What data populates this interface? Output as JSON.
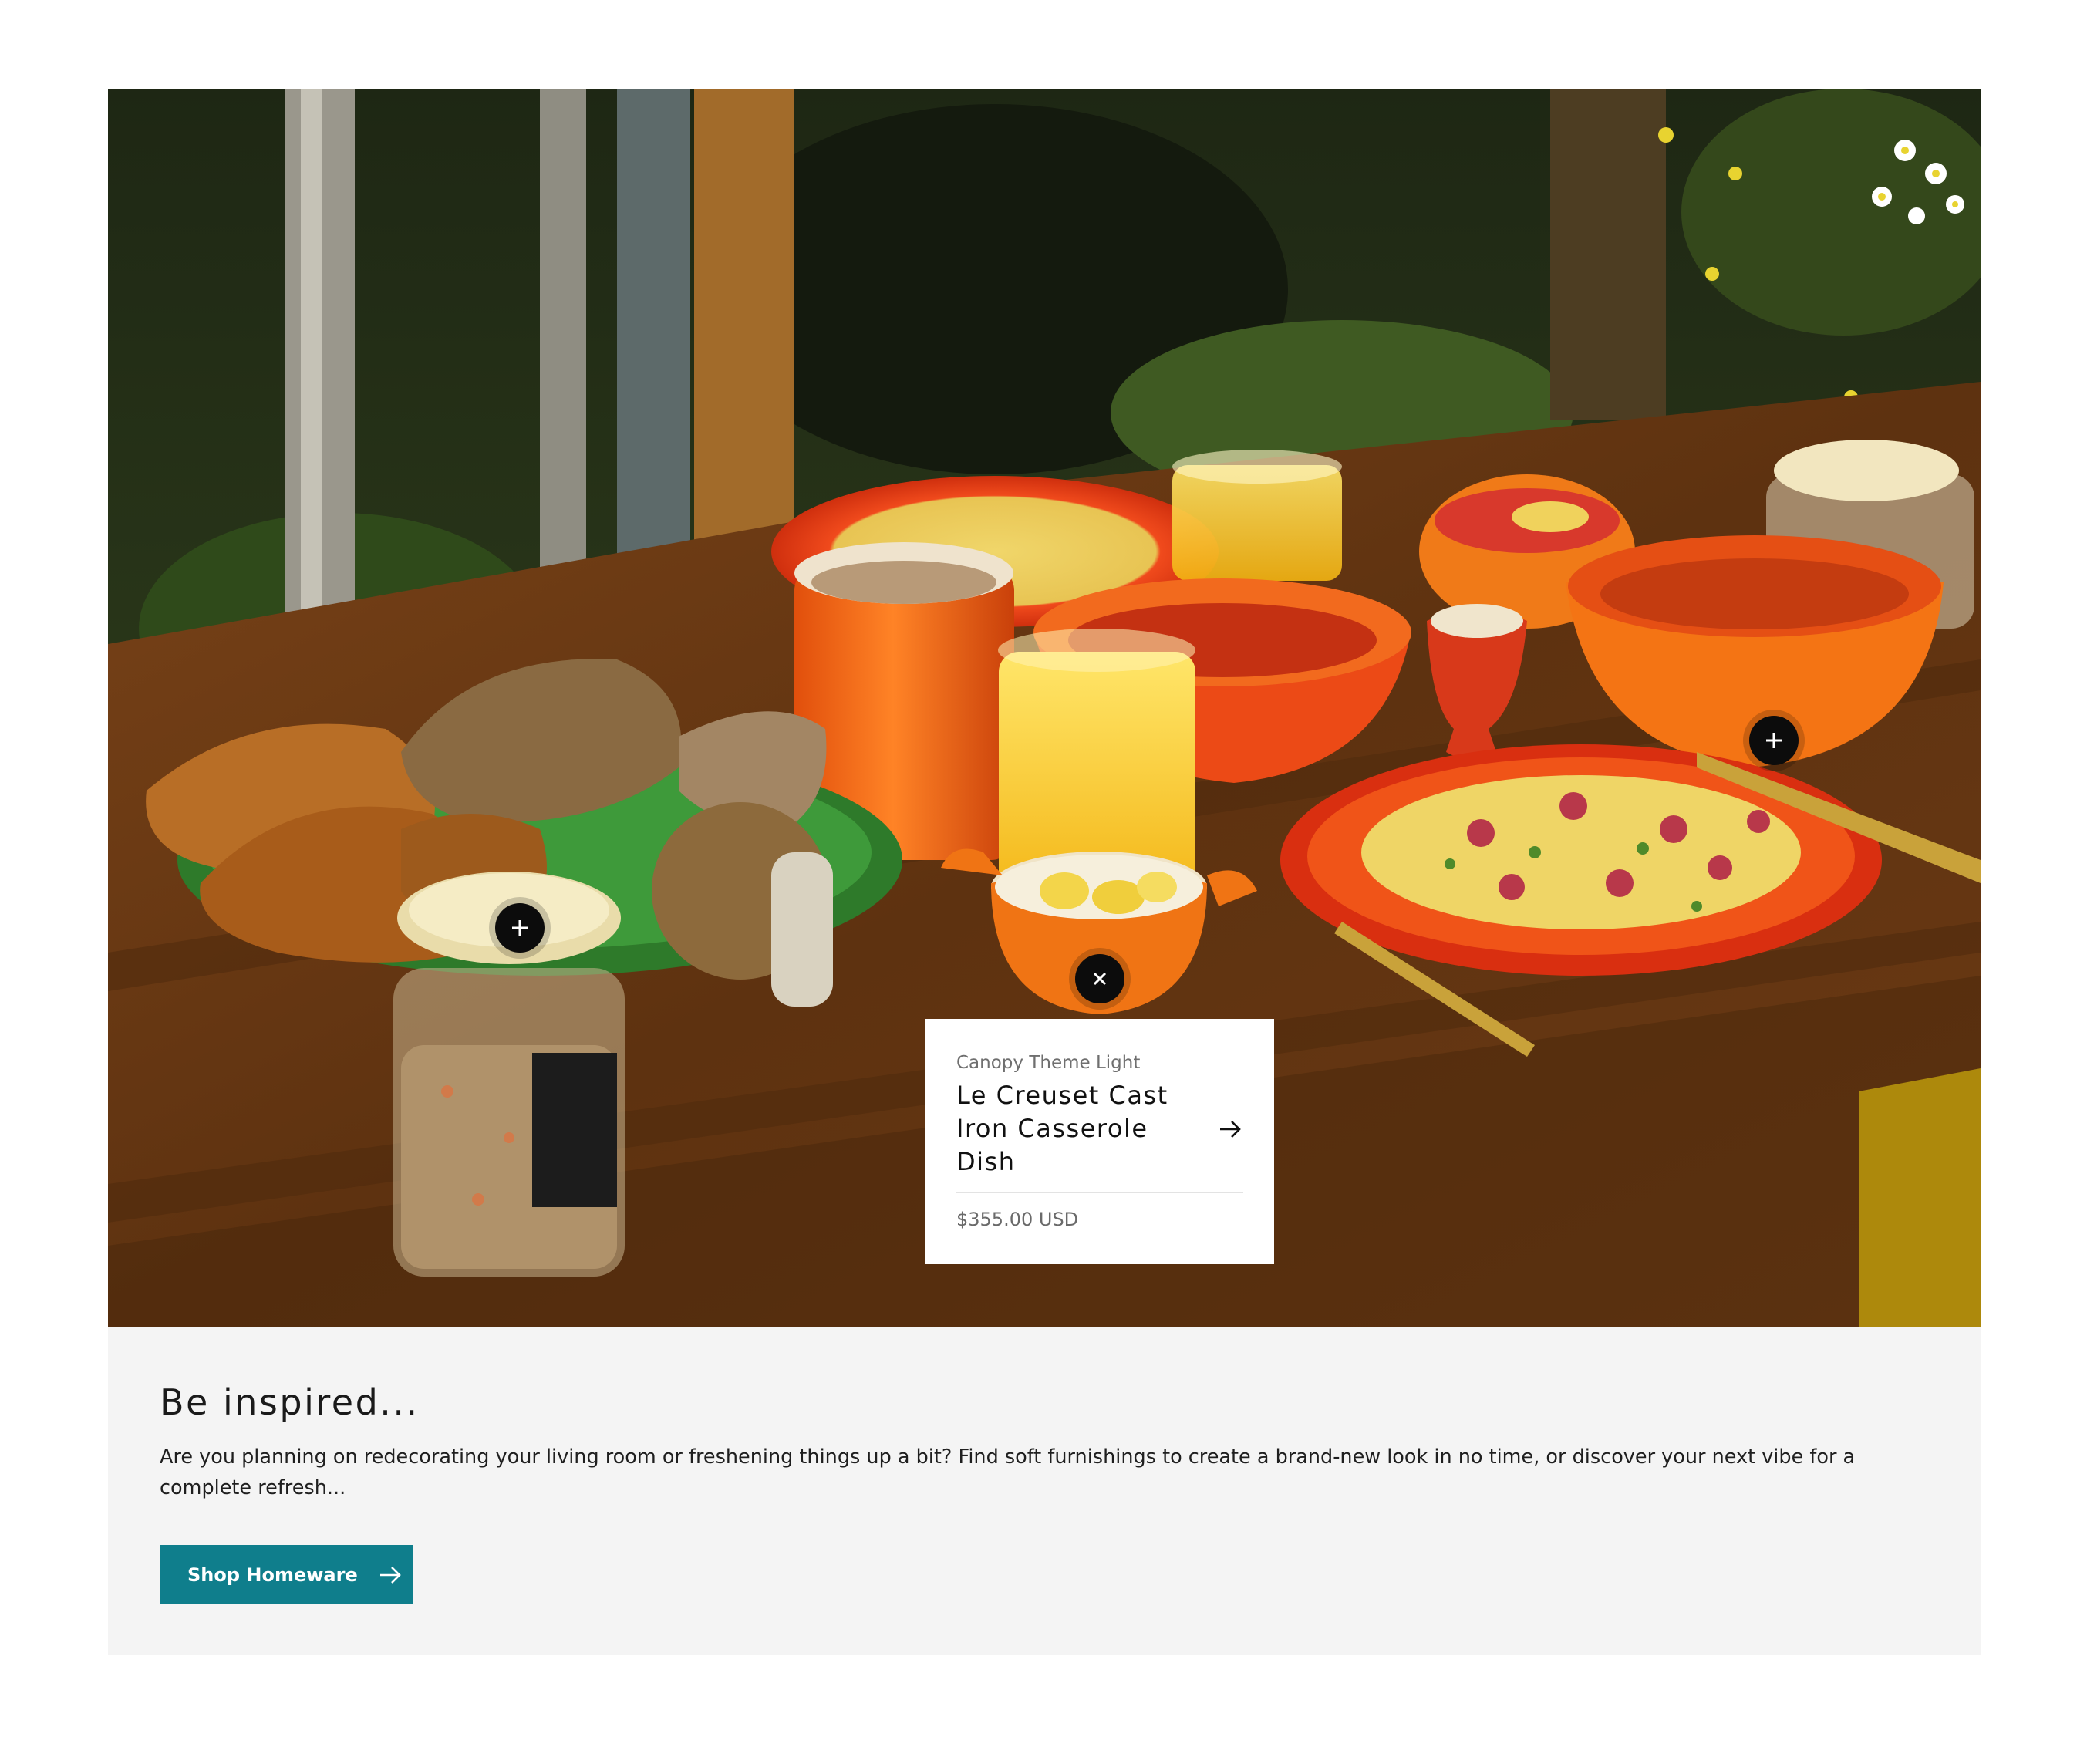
{
  "hero": {
    "scene": "outdoor breakfast table with orange cast iron cookware, bread, juice and a glass jar of granola",
    "hotspots": [
      {
        "name": "jar",
        "icon": "plus-icon",
        "state": "closed"
      },
      {
        "name": "bowl",
        "icon": "plus-icon",
        "state": "closed"
      },
      {
        "name": "casserole",
        "icon": "close-icon",
        "state": "open"
      }
    ]
  },
  "product_card": {
    "vendor": "Canopy Theme Light",
    "title": "Le Creuset Cast Iron Casserole Dish",
    "price": "$355.00 USD",
    "arrow_icon": "arrow-right-icon"
  },
  "panel": {
    "title": "Be inspired...",
    "text": "Are you planning on redecorating your living room or freshening things up a bit? Find soft furnishings to create a brand-new look in no time, or discover your next vibe for a complete refresh...",
    "button_label": "Shop Homeware",
    "button_icon": "arrow-right-icon"
  },
  "colors": {
    "accent": "#0f7e8c",
    "panel_bg": "#f4f4f4",
    "hotspot": "#0c0c0c",
    "cookware_orange": "#f06a12",
    "cookware_red": "#e5421a"
  }
}
